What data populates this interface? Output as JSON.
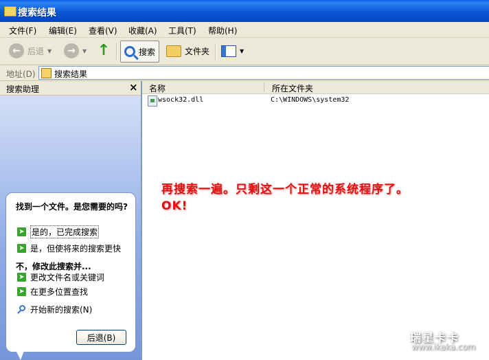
{
  "window": {
    "title": "搜索结果"
  },
  "menu": [
    "文件(F)",
    "编辑(E)",
    "查看(V)",
    "收藏(A)",
    "工具(T)",
    "帮助(H)"
  ],
  "toolbar": {
    "back": "后退",
    "search": "搜索",
    "folders": "文件夹"
  },
  "address": {
    "label": "地址(D)",
    "value": "搜索结果"
  },
  "pane": {
    "title": "搜索助理",
    "close": "×",
    "question": "找到一个文件。是您需要的吗?",
    "options": [
      "是的，已完成搜索",
      "是，但使将来的搜索更快"
    ],
    "subheading": "不，修改此搜索并...",
    "refine_options": [
      "更改文件名或关键词",
      "在更多位置查找"
    ],
    "new_search": "开始新的搜索(N)",
    "back_button": "后退(B)"
  },
  "columns": {
    "name": "名称",
    "folder": "所在文件夹"
  },
  "results": [
    {
      "name": "wsock32.dll",
      "folder": "C:\\WINDOWS\\system32"
    }
  ],
  "annotation": "再搜索一遍。只剩这一个正常的系统程序了。OK!",
  "watermark": {
    "brand": "瑞星卡卡",
    "url": "www.ikaka.com"
  }
}
